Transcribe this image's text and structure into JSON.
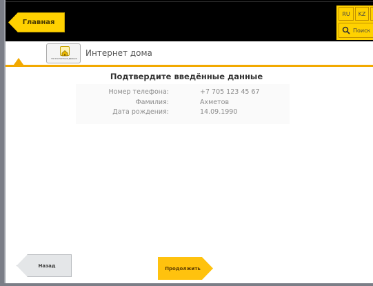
{
  "header": {
    "home_label": "Главная",
    "languages": [
      "RU",
      "KZ"
    ],
    "search_label": "Поиск"
  },
  "service": {
    "title": "Интернет дома",
    "logo_caption": "Ои контактные данные"
  },
  "confirmation": {
    "title": "Подтвердите введённые данные",
    "fields": [
      {
        "label": "Номер телефона:",
        "value": "+7 705 123 45 67"
      },
      {
        "label": "Фамилия:",
        "value": "Ахметов"
      },
      {
        "label": "Дата рождения:",
        "value": "14.09.1990"
      }
    ]
  },
  "footer": {
    "back_label": "Назад",
    "next_label": "Продолжить"
  },
  "colors": {
    "accent_yellow": "#ffd100",
    "continue_yellow": "#ffc20e",
    "underline_orange": "#f2a900",
    "topbar": "#000000"
  }
}
